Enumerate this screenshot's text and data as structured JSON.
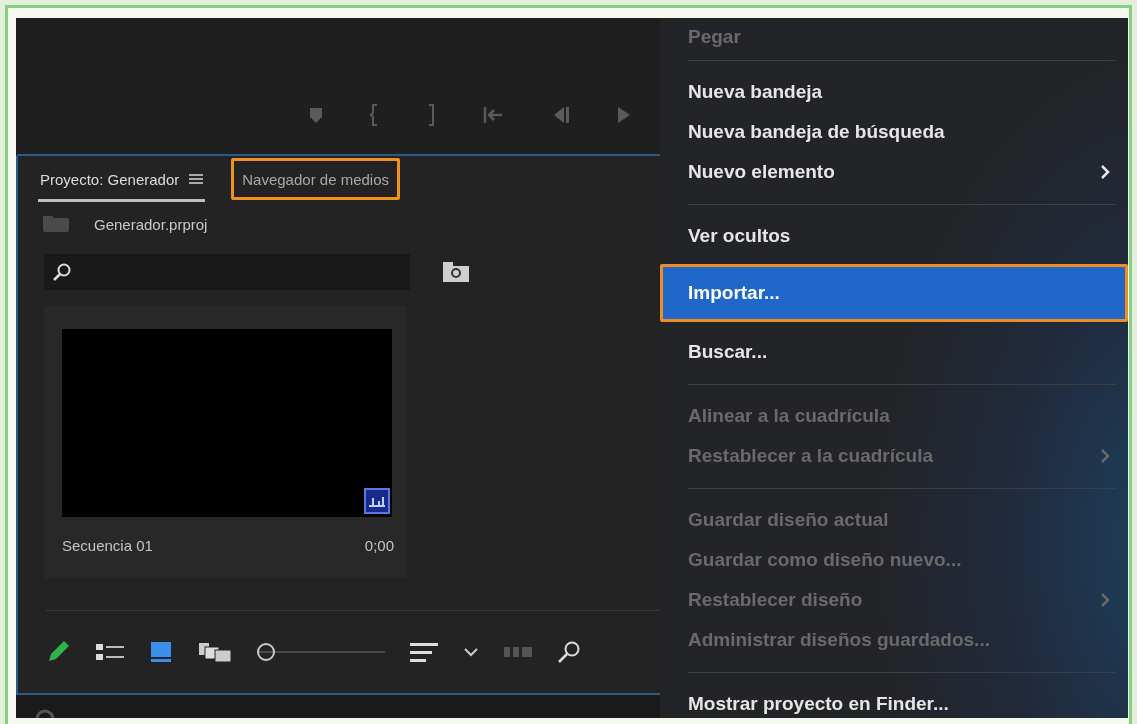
{
  "project_panel": {
    "tabs": [
      {
        "label": "Proyecto: Generador",
        "selected": true,
        "annotated": false
      },
      {
        "label": "Navegador de medios",
        "selected": false,
        "annotated": true
      }
    ],
    "project_file": "Generador.prproj",
    "items": [
      {
        "name": "Secuencia 01",
        "duration": "0;00"
      }
    ],
    "zoom_slider": {
      "level": 0
    }
  },
  "context_menu": {
    "items": [
      {
        "kind": "item",
        "label": "Pegar",
        "disabled": true,
        "submenu": false,
        "selected": false,
        "annotated": false
      },
      {
        "kind": "separator"
      },
      {
        "kind": "item",
        "label": "Nueva bandeja",
        "disabled": false,
        "submenu": false,
        "selected": false,
        "annotated": false
      },
      {
        "kind": "item",
        "label": "Nueva bandeja de búsqueda",
        "disabled": false,
        "submenu": false,
        "selected": false,
        "annotated": false
      },
      {
        "kind": "item",
        "label": "Nuevo elemento",
        "disabled": false,
        "submenu": true,
        "selected": false,
        "annotated": false
      },
      {
        "kind": "separator"
      },
      {
        "kind": "item",
        "label": "Ver ocultos",
        "disabled": false,
        "submenu": false,
        "selected": false,
        "annotated": false
      },
      {
        "kind": "item",
        "label": "Importar...",
        "disabled": false,
        "submenu": false,
        "selected": true,
        "annotated": true
      },
      {
        "kind": "item",
        "label": "Buscar...",
        "disabled": false,
        "submenu": false,
        "selected": false,
        "annotated": false
      },
      {
        "kind": "separator"
      },
      {
        "kind": "item",
        "label": "Alinear a la cuadrícula",
        "disabled": true,
        "submenu": false,
        "selected": false,
        "annotated": false
      },
      {
        "kind": "item",
        "label": "Restablecer a la cuadrícula",
        "disabled": true,
        "submenu": true,
        "selected": false,
        "annotated": false
      },
      {
        "kind": "separator"
      },
      {
        "kind": "item",
        "label": "Guardar diseño actual",
        "disabled": true,
        "submenu": false,
        "selected": false,
        "annotated": false
      },
      {
        "kind": "item",
        "label": "Guardar como diseño nuevo...",
        "disabled": true,
        "submenu": false,
        "selected": false,
        "annotated": false
      },
      {
        "kind": "item",
        "label": "Restablecer diseño",
        "disabled": true,
        "submenu": true,
        "selected": false,
        "annotated": false
      },
      {
        "kind": "item",
        "label": "Administrar diseños guardados...",
        "disabled": true,
        "submenu": false,
        "selected": false,
        "annotated": false
      },
      {
        "kind": "separator"
      },
      {
        "kind": "item",
        "label": "Mostrar proyecto en Finder...",
        "disabled": false,
        "submenu": false,
        "selected": false,
        "annotated": false
      }
    ]
  }
}
